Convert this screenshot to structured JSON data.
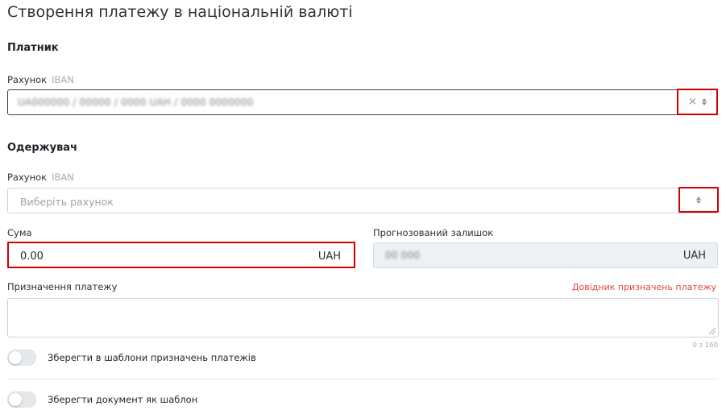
{
  "page": {
    "title": "Створення платежу в національній валюті"
  },
  "payer": {
    "section_title": "Платник",
    "account_label": "Рахунок",
    "account_hint": "IBAN",
    "account_value": "UA000000 / 00000 / 0000 UAH / 0000 0000000",
    "clear_icon": "×"
  },
  "recipient": {
    "section_title": "Одержувач",
    "account_label": "Рахунок",
    "account_hint": "IBAN",
    "account_placeholder": "Виберіть рахунок"
  },
  "amount": {
    "label": "Сума",
    "value": "0.00",
    "currency": "UAH"
  },
  "forecast": {
    "label": "Прогнозований залишок",
    "value": "00 000",
    "currency": "UAH"
  },
  "purpose": {
    "label": "Призначення платежу",
    "reference_link": "Довідник призначень платежу",
    "counter": "0 з 160"
  },
  "toggles": {
    "save_to_templates": "Зберегти в шаблони призначень платежів",
    "save_as_template": "Зберегти документ як шаблон"
  },
  "colors": {
    "highlight": "#d40000",
    "link": "#e0463f"
  },
  "icons": {
    "clear": "close-icon",
    "select": "sort-arrows-icon"
  }
}
